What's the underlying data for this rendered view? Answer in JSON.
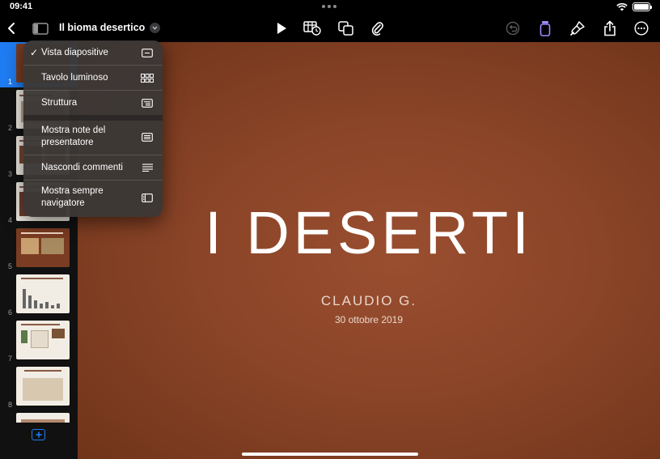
{
  "status_bar": {
    "time": "09:41",
    "battery_level": 1.0
  },
  "toolbar": {
    "document_title": "Il bioma desertico"
  },
  "navigator": {
    "slides": [
      {
        "number": "1",
        "selected": true
      },
      {
        "number": "2"
      },
      {
        "number": "3"
      },
      {
        "number": "4"
      },
      {
        "number": "5"
      },
      {
        "number": "6"
      },
      {
        "number": "7"
      },
      {
        "number": "8"
      }
    ]
  },
  "slide": {
    "title": "I DESERTI",
    "author": "CLAUDIO G.",
    "date": "30 ottobre 2019"
  },
  "view_menu": {
    "items": [
      {
        "label": "Vista diapositive",
        "checked": true,
        "icon": "slide-view-icon"
      },
      {
        "label": "Tavolo luminoso",
        "icon": "light-table-icon"
      },
      {
        "label": "Struttura",
        "icon": "outline-icon"
      },
      {
        "label": "Mostra note del presentatore",
        "icon": "presenter-notes-icon"
      },
      {
        "label": "Nascondi commenti",
        "icon": "comments-icon"
      },
      {
        "label": "Mostra sempre navigatore",
        "icon": "navigator-icon"
      }
    ]
  },
  "colors": {
    "accent": "#1f7cf2",
    "slide_background": "#8a4427",
    "toolbar_active_icon": "#9b8cff"
  }
}
